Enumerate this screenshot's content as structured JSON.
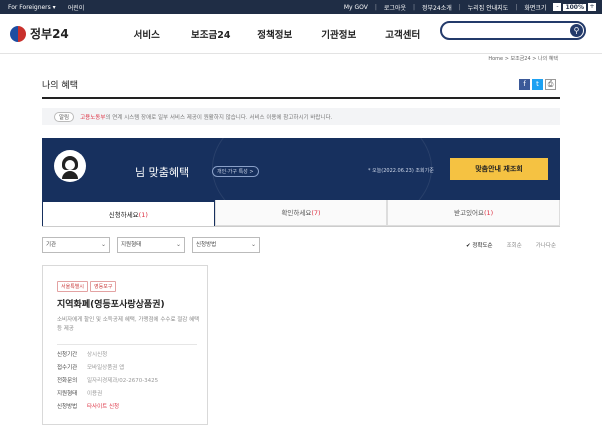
{
  "topbar": {
    "foreigners": "For Foreigners ▾",
    "mobile": "어린이",
    "mygov": "My GOV",
    "logout": "로그아웃",
    "about": "정부24소개",
    "sitemap": "누리집 안내지도",
    "zoom_label": "화면크기",
    "zoom_minus": "-",
    "zoom_value": "100%",
    "zoom_plus": "+"
  },
  "header": {
    "logo": "정부24",
    "nav": [
      "서비스",
      "보조금24",
      "정책정보",
      "기관정보",
      "고객센터"
    ],
    "search_placeholder": ""
  },
  "breadcrumb": "Home  >  보조금24  >  나의 혜택",
  "page": {
    "title": "나의 혜택"
  },
  "share": [
    "f",
    "t",
    "⎙"
  ],
  "notice": {
    "tag": "알림",
    "red": "고용노동부",
    "text": "의 연계 시스템 장애로 일부 서비스 제공이 원활하지 않습니다. 서비스 이용에 참고하시기 바랍니다."
  },
  "banner": {
    "title": "님 맞춤혜택",
    "pill": "개인·가구 특성 >",
    "date": "* 오늘(2022.06.23) 조회기준",
    "button": "맞춤안내 재조회"
  },
  "tabs": [
    {
      "label": "신청하세요",
      "count": "(1)"
    },
    {
      "label": "확인하세요",
      "count": "(7)"
    },
    {
      "label": "받고있어요",
      "count": "(1)"
    }
  ],
  "filters": [
    "기관",
    "지원형태",
    "신청방법"
  ],
  "sort": [
    "✔ 정확도순",
    "조회순",
    "가나다순"
  ],
  "card": {
    "tags": [
      "서울특별시",
      "영등포구"
    ],
    "title": "지역화폐(영등포사랑상품권)",
    "desc": "소비자에게 할인 및 소득공제 혜택, 가맹점에 수수료 절감 혜택 등 제공",
    "info": [
      {
        "k": "신청기간",
        "v": "상시신청"
      },
      {
        "k": "접수기관",
        "v": "모바일상품권 앱"
      },
      {
        "k": "전화문의",
        "v": "일자리경제과/02-2670-3425"
      },
      {
        "k": "지원형태",
        "v": "이용권"
      },
      {
        "k": "신청방법",
        "v": "타사이트 신청"
      }
    ]
  },
  "colors": {
    "navy": "#17305e",
    "accent": "#f5c242",
    "red": "#d34"
  }
}
